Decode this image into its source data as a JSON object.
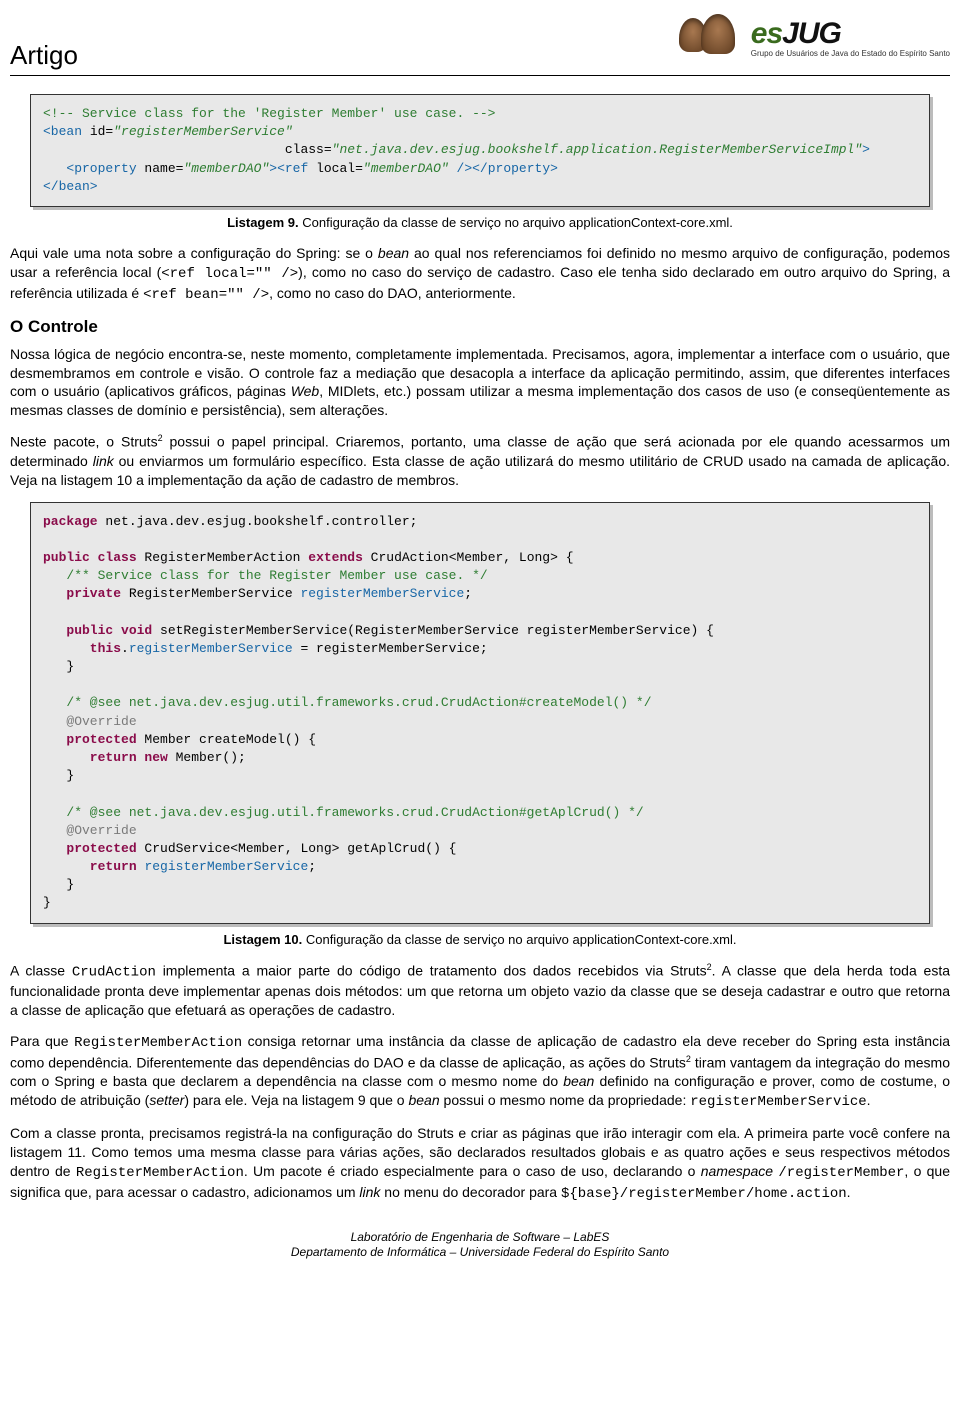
{
  "header": {
    "title": "Artigo",
    "logo_text_a": "es",
    "logo_text_b": "JUG",
    "logo_sub": "Grupo de Usuários de Java do Estado do Espírito Santo"
  },
  "code1": {
    "l1a": "<!-- Service class for the 'Register Member' use case. -->",
    "l2a": "<bean",
    "l2b": " id=",
    "l2c": "\"registerMemberService\"",
    "l3a": "                               class=",
    "l3b": "\"net.java.dev.esjug.bookshelf.application.RegisterMemberServiceImpl\"",
    "l3c": ">",
    "l4a": "   <property",
    "l4b": " name=",
    "l4c": "\"memberDAO\"",
    "l4d": "><ref",
    "l4e": " local=",
    "l4f": "\"memberDAO\"",
    "l4g": " /></property>",
    "l5a": "</bean>"
  },
  "caption1": {
    "bold": "Listagem 9.",
    "rest": " Configuração da classe de serviço no arquivo applicationContext-core.xml."
  },
  "para1": {
    "a": "Aqui vale uma nota sobre a configuração do Spring: se o ",
    "b": "bean",
    "c": " ao qual nos referenciamos foi definido no mesmo arquivo de configuração, podemos usar a referência local (",
    "d": "<ref local=\"\" />",
    "e": "), como no caso do serviço de cadastro. Caso ele tenha sido declarado em outro arquivo do Spring, a referência utilizada é ",
    "f": "<ref bean=\"\" />",
    "g": ", como no caso do DAO, anteriormente."
  },
  "section1": "O Controle",
  "para2": "Nossa lógica de negócio encontra-se, neste momento, completamente implementada. Precisamos, agora, implementar a interface com o usuário, que desmembramos em controle e visão. O controle faz a mediação que desacopla a interface da aplicação permitindo, assim, que diferentes interfaces com o usuário (aplicativos gráficos, páginas ",
  "para2b": "Web",
  "para2c": ", MIDlets, etc.) possam utilizar a mesma implementação dos casos de uso (e conseqüentemente as mesmas classes de domínio e persistência), sem alterações.",
  "para3": {
    "a": "Neste pacote, o Struts",
    "sup": "2",
    "b": " possui o papel principal. Criaremos, portanto, uma classe de ação que será acionada por ele quando acessarmos um determinado ",
    "c": "link",
    "d": " ou enviarmos um formulário específico. Esta classe de ação utilizará do mesmo utilitário de CRUD usado na camada de aplicação. Veja na listagem 10 a implementação da ação de cadastro de membros."
  },
  "code2": {
    "l01a": "package",
    "l01b": " net.java.dev.esjug.bookshelf.controller;",
    "l02a": "public class",
    "l02b": " RegisterMemberAction ",
    "l02c": "extends",
    "l02d": " CrudAction<Member, Long> {",
    "l03a": "   /** Service class for the Register Member use case. */",
    "l04a": "   private",
    "l04b": " RegisterMemberService ",
    "l04c": "registerMemberService",
    "l04d": ";",
    "l05a": "   public void",
    "l05b": " setRegisterMemberService(RegisterMemberService registerMemberService) {",
    "l06a": "      this",
    "l06b": ".",
    "l06c": "registerMemberService",
    "l06d": " = registerMemberService;",
    "l07a": "   }",
    "l08a": "   /* @see net.java.dev.esjug.util.frameworks.crud.CrudAction#createModel() */",
    "l09a": "   @Override",
    "l10a": "   protected",
    "l10b": " Member createModel() {",
    "l11a": "      return new",
    "l11b": " Member();",
    "l12a": "   }",
    "l13a": "   /* @see net.java.dev.esjug.util.frameworks.crud.CrudAction#getAplCrud() */",
    "l14a": "   @Override",
    "l15a": "   protected",
    "l15b": " CrudService<Member, Long> getAplCrud() {",
    "l16a": "      return",
    "l16b": " ",
    "l16c": "registerMemberService",
    "l16d": ";",
    "l17a": "   }",
    "l18a": "}"
  },
  "caption2": {
    "bold": "Listagem 10.",
    "rest": " Configuração da classe de serviço no arquivo applicationContext-core.xml."
  },
  "para4": {
    "a": "A classe ",
    "b": "CrudAction",
    "c": " implementa a maior parte do código de tratamento dos dados recebidos via Struts",
    "sup": "2",
    "d": ". A classe que dela herda toda esta funcionalidade pronta deve implementar apenas dois métodos: um que retorna um objeto vazio da classe que se deseja cadastrar e outro que retorna a classe de aplicação que efetuará as operações de cadastro."
  },
  "para5": {
    "a": "Para que ",
    "b": "RegisterMemberAction",
    "c": " consiga retornar uma instância da classe de aplicação de cadastro ela deve receber do Spring esta instância como dependência. Diferentemente das dependências do DAO e da classe de aplicação, as ações do Struts",
    "sup": "2",
    "d": " tiram vantagem da integração do mesmo com o Spring e basta que declarem a dependência na classe com o mesmo nome do ",
    "e": "bean",
    "f": " definido na configuração e prover, como de costume, o método de atribuição (",
    "g": "setter",
    "h": ") para ele. Veja na listagem 9 que o ",
    "i": "bean",
    "j": " possui o mesmo nome da propriedade: ",
    "k": "registerMemberService",
    "l": "."
  },
  "para6": {
    "a": "Com a classe pronta, precisamos registrá-la na configuração do Struts e criar as páginas que irão interagir com ela. A primeira parte você confere na listagem 11. Como temos uma mesma classe para várias ações, são declarados resultados globais e as quatro ações e seus respectivos métodos dentro de ",
    "b": "RegisterMemberAction",
    "c": ". Um pacote é criado especialmente para o caso de uso, declarando o ",
    "d": "namespace",
    "e": " ",
    "f": "/registerMember",
    "g": ", o que significa que, para acessar o cadastro, adicionamos um ",
    "h": "link",
    "i": " no menu do decorador para ",
    "j": "${base}/registerMember/home.action",
    "k": "."
  },
  "footer": {
    "line1": "Laboratório de Engenharia de Software – LabES",
    "line2": "Departamento de Informática – Universidade Federal do Espírito Santo"
  }
}
